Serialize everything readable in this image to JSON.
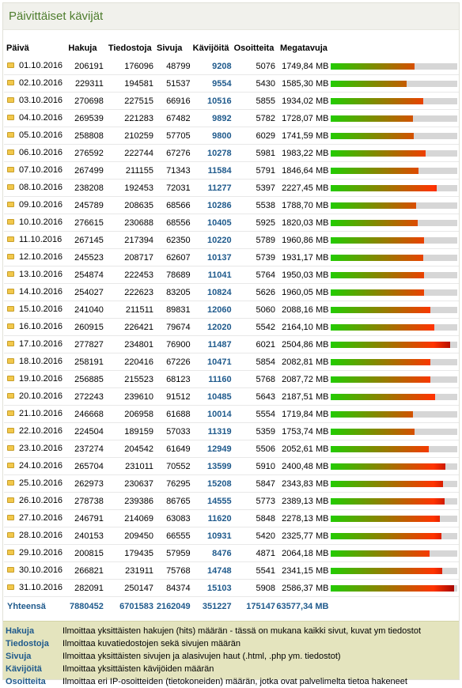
{
  "title": "Päivittäiset kävijät",
  "headers": {
    "date": "Päivä",
    "hits": "Hakuja",
    "files": "Tiedostoja",
    "pages": "Sivuja",
    "visits": "Kävijöitä",
    "sites": "Osoitteita",
    "mb": "Megatavuja"
  },
  "bar_scale_max_mb": 2650,
  "rows": [
    {
      "date": "01.10.2016",
      "hits": "206191",
      "files": "176096",
      "pages": "48799",
      "visits": "9208",
      "sites": "5076",
      "mb": "1749,84 MB",
      "mb_value": 1749.84
    },
    {
      "date": "02.10.2016",
      "hits": "229311",
      "files": "194581",
      "pages": "51537",
      "visits": "9554",
      "sites": "5430",
      "mb": "1585,30 MB",
      "mb_value": 1585.3
    },
    {
      "date": "03.10.2016",
      "hits": "270698",
      "files": "227515",
      "pages": "66916",
      "visits": "10516",
      "sites": "5855",
      "mb": "1934,02 MB",
      "mb_value": 1934.02
    },
    {
      "date": "04.10.2016",
      "hits": "269539",
      "files": "221283",
      "pages": "67482",
      "visits": "9892",
      "sites": "5782",
      "mb": "1728,07 MB",
      "mb_value": 1728.07
    },
    {
      "date": "05.10.2016",
      "hits": "258808",
      "files": "210259",
      "pages": "57705",
      "visits": "9800",
      "sites": "6029",
      "mb": "1741,59 MB",
      "mb_value": 1741.59
    },
    {
      "date": "06.10.2016",
      "hits": "276592",
      "files": "222744",
      "pages": "67276",
      "visits": "10278",
      "sites": "5981",
      "mb": "1983,22 MB",
      "mb_value": 1983.22
    },
    {
      "date": "07.10.2016",
      "hits": "267499",
      "files": "211155",
      "pages": "71343",
      "visits": "11584",
      "sites": "5791",
      "mb": "1846,64 MB",
      "mb_value": 1846.64
    },
    {
      "date": "08.10.2016",
      "hits": "238208",
      "files": "192453",
      "pages": "72031",
      "visits": "11277",
      "sites": "5397",
      "mb": "2227,45 MB",
      "mb_value": 2227.45
    },
    {
      "date": "09.10.2016",
      "hits": "245789",
      "files": "208635",
      "pages": "68566",
      "visits": "10286",
      "sites": "5538",
      "mb": "1788,70 MB",
      "mb_value": 1788.7
    },
    {
      "date": "10.10.2016",
      "hits": "276615",
      "files": "230688",
      "pages": "68556",
      "visits": "10405",
      "sites": "5925",
      "mb": "1820,03 MB",
      "mb_value": 1820.03
    },
    {
      "date": "11.10.2016",
      "hits": "267145",
      "files": "217394",
      "pages": "62350",
      "visits": "10220",
      "sites": "5789",
      "mb": "1960,86 MB",
      "mb_value": 1960.86
    },
    {
      "date": "12.10.2016",
      "hits": "245523",
      "files": "208717",
      "pages": "62607",
      "visits": "10137",
      "sites": "5739",
      "mb": "1931,17 MB",
      "mb_value": 1931.17
    },
    {
      "date": "13.10.2016",
      "hits": "254874",
      "files": "222453",
      "pages": "78689",
      "visits": "11041",
      "sites": "5764",
      "mb": "1950,03 MB",
      "mb_value": 1950.03
    },
    {
      "date": "14.10.2016",
      "hits": "254027",
      "files": "222623",
      "pages": "83205",
      "visits": "10824",
      "sites": "5626",
      "mb": "1960,05 MB",
      "mb_value": 1960.05
    },
    {
      "date": "15.10.2016",
      "hits": "241040",
      "files": "211511",
      "pages": "89831",
      "visits": "12060",
      "sites": "5060",
      "mb": "2088,16 MB",
      "mb_value": 2088.16
    },
    {
      "date": "16.10.2016",
      "hits": "260915",
      "files": "226421",
      "pages": "79674",
      "visits": "12020",
      "sites": "5542",
      "mb": "2164,10 MB",
      "mb_value": 2164.1
    },
    {
      "date": "17.10.2016",
      "hits": "277827",
      "files": "234801",
      "pages": "76900",
      "visits": "11487",
      "sites": "6021",
      "mb": "2504,86 MB",
      "mb_value": 2504.86
    },
    {
      "date": "18.10.2016",
      "hits": "258191",
      "files": "220416",
      "pages": "67226",
      "visits": "10471",
      "sites": "5854",
      "mb": "2082,81 MB",
      "mb_value": 2082.81
    },
    {
      "date": "19.10.2016",
      "hits": "256885",
      "files": "215523",
      "pages": "68123",
      "visits": "11160",
      "sites": "5768",
      "mb": "2087,72 MB",
      "mb_value": 2087.72
    },
    {
      "date": "20.10.2016",
      "hits": "272243",
      "files": "239610",
      "pages": "91512",
      "visits": "10485",
      "sites": "5643",
      "mb": "2187,51 MB",
      "mb_value": 2187.51
    },
    {
      "date": "21.10.2016",
      "hits": "246668",
      "files": "206958",
      "pages": "61688",
      "visits": "10014",
      "sites": "5554",
      "mb": "1719,84 MB",
      "mb_value": 1719.84
    },
    {
      "date": "22.10.2016",
      "hits": "224504",
      "files": "189159",
      "pages": "57033",
      "visits": "11319",
      "sites": "5359",
      "mb": "1753,74 MB",
      "mb_value": 1753.74
    },
    {
      "date": "23.10.2016",
      "hits": "237274",
      "files": "204542",
      "pages": "61649",
      "visits": "12949",
      "sites": "5506",
      "mb": "2052,61 MB",
      "mb_value": 2052.61
    },
    {
      "date": "24.10.2016",
      "hits": "265704",
      "files": "231011",
      "pages": "70552",
      "visits": "13599",
      "sites": "5910",
      "mb": "2400,48 MB",
      "mb_value": 2400.48
    },
    {
      "date": "25.10.2016",
      "hits": "262973",
      "files": "230637",
      "pages": "76295",
      "visits": "15208",
      "sites": "5847",
      "mb": "2343,83 MB",
      "mb_value": 2343.83
    },
    {
      "date": "26.10.2016",
      "hits": "278738",
      "files": "239386",
      "pages": "86765",
      "visits": "14555",
      "sites": "5773",
      "mb": "2389,13 MB",
      "mb_value": 2389.13
    },
    {
      "date": "27.10.2016",
      "hits": "246791",
      "files": "214069",
      "pages": "63083",
      "visits": "11620",
      "sites": "5848",
      "mb": "2278,13 MB",
      "mb_value": 2278.13
    },
    {
      "date": "28.10.2016",
      "hits": "240153",
      "files": "209450",
      "pages": "66555",
      "visits": "10931",
      "sites": "5420",
      "mb": "2325,77 MB",
      "mb_value": 2325.77
    },
    {
      "date": "29.10.2016",
      "hits": "200815",
      "files": "179435",
      "pages": "57959",
      "visits": "8476",
      "sites": "4871",
      "mb": "2064,18 MB",
      "mb_value": 2064.18
    },
    {
      "date": "30.10.2016",
      "hits": "266821",
      "files": "231911",
      "pages": "75768",
      "visits": "14748",
      "sites": "5541",
      "mb": "2341,15 MB",
      "mb_value": 2341.15
    },
    {
      "date": "31.10.2016",
      "hits": "282091",
      "files": "250147",
      "pages": "84374",
      "visits": "15103",
      "sites": "5908",
      "mb": "2586,37 MB",
      "mb_value": 2586.37
    }
  ],
  "totals": {
    "label": "Yhteensä",
    "hits": "7880452",
    "files": "6701583",
    "pages": "2162049",
    "visits": "351227",
    "sites": "175147",
    "mb": "63577,34 MB"
  },
  "legend": [
    {
      "key": "Hakuja",
      "desc": "Ilmoittaa yksittäisten hakujen (hits) määrän - tässä on mukana kaikki sivut, kuvat ym tiedostot"
    },
    {
      "key": "Tiedostoja",
      "desc": "Ilmoittaa kuvatiedostojen sekä sivujen määrän"
    },
    {
      "key": "Sivuja",
      "desc": "Ilmoittaa yksittäisten sivujen ja alasivujen haut (.html, .php ym. tiedostot)"
    },
    {
      "key": "Kävijöitä",
      "desc": "Ilmoittaa yksittäisten kävijöiden määrän"
    },
    {
      "key": "Osoitteita",
      "desc": "Ilmoittaa eri IP-osoitteiden (tietokoneiden) määrän, jotka ovat palvelimelta tietoa hakeneet"
    }
  ],
  "colors": {
    "accent_blue": "#1f5a8c",
    "title_green": "#4e7d2e",
    "bar_start": "#22cc00",
    "bar_mid": "#ff3300",
    "bar_end": "#990000",
    "bar_track": "#d6d6d6",
    "legend_bg": "#e4e4be"
  },
  "icons": {
    "row_marker": "folder-icon"
  }
}
